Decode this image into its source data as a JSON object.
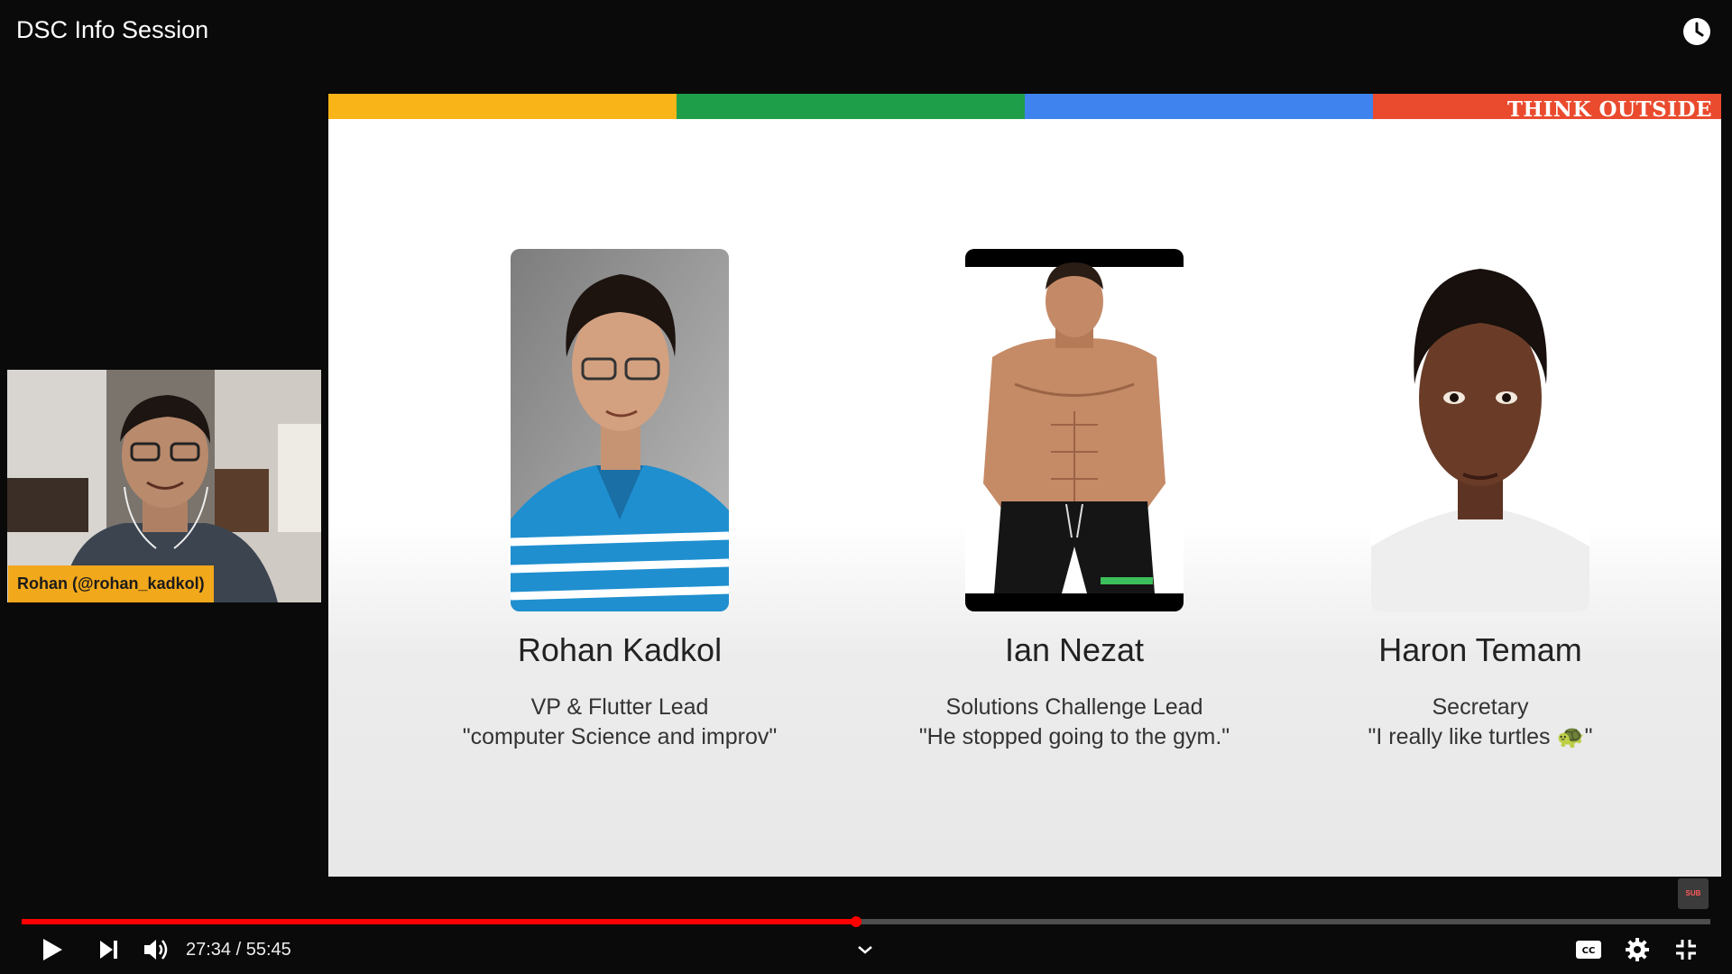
{
  "video": {
    "title": "DSC Info Session",
    "current_time": "27:34",
    "duration": "55:45",
    "time_display": "27:34 / 55:45",
    "progress_fraction": 0.494
  },
  "slide": {
    "banner_text": "THINK OUTSIDE",
    "bar_colors": [
      "#f9b418",
      "#1e9e48",
      "#3f84ee",
      "#ea4a2d"
    ],
    "members": [
      {
        "name": "Rohan Kadkol",
        "role": "VP & Flutter Lead",
        "quote": "\"computer Science and improv\""
      },
      {
        "name": "Ian Nezat",
        "role": "Solutions Challenge Lead",
        "quote": "\"He stopped going to the gym.\""
      },
      {
        "name": "Haron Temam",
        "role": "Secretary",
        "quote": "\"I really like turtles 🐢\""
      }
    ]
  },
  "webcam": {
    "label": "Rohan (@rohan_kadkol)"
  },
  "corner_logo": {
    "text": "SUB"
  },
  "colors": {
    "progress": "#ff0000",
    "webcam_label_bg": "#f2a81b"
  },
  "icons": [
    "watch-later-icon",
    "play-icon",
    "next-icon",
    "volume-icon",
    "chevron-down-icon",
    "captions-icon",
    "settings-icon",
    "exit-fullscreen-icon"
  ]
}
